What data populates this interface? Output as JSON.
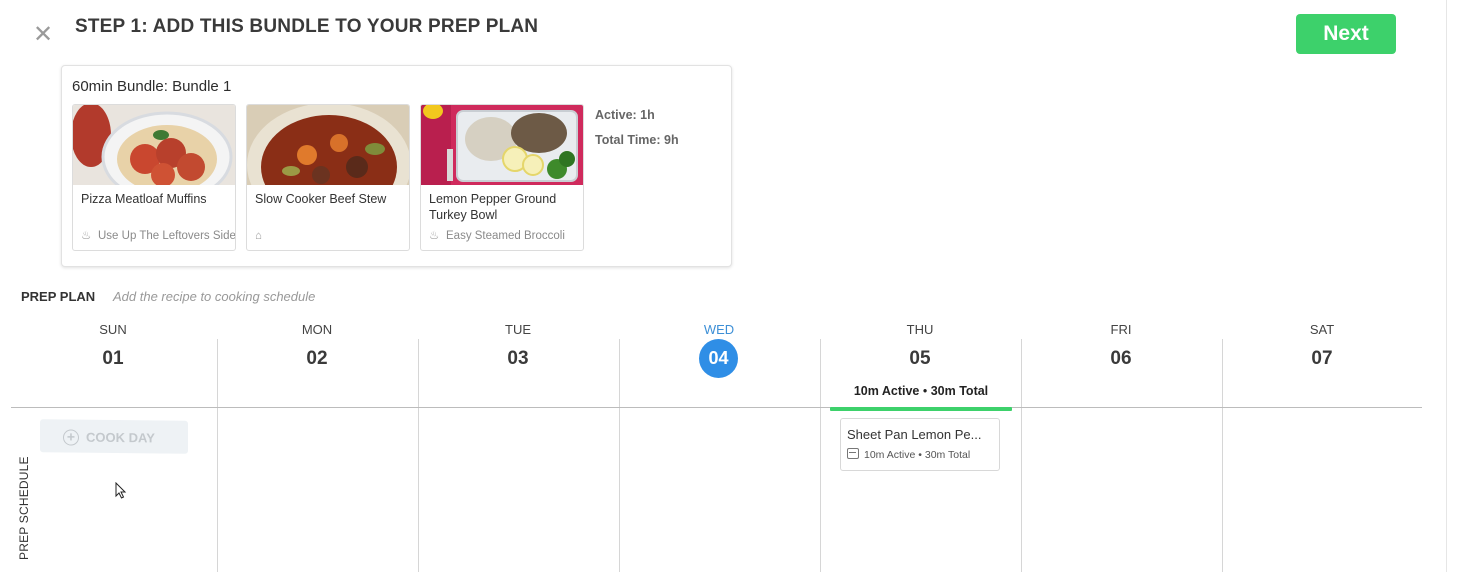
{
  "header": {
    "title": "STEP 1: ADD THIS BUNDLE TO YOUR PREP PLAN",
    "next_label": "Next",
    "close_icon": "close-icon"
  },
  "bundle": {
    "title": "60min Bundle: Bundle 1",
    "recipes": [
      {
        "name": "Pizza Meatloaf Muffins",
        "side": "Use Up The Leftovers Side",
        "side_icon": "steam-icon"
      },
      {
        "name": "Slow Cooker Beef Stew",
        "side": "",
        "side_icon": "slow-cooker-icon"
      },
      {
        "name": "Lemon Pepper Ground Turkey Bowl",
        "side": "Easy Steamed Broccoli",
        "side_icon": "steam-icon"
      }
    ],
    "active": "Active: 1h",
    "total": "Total Time: 9h"
  },
  "prep_plan": {
    "label": "PREP PLAN",
    "hint": "Add the recipe to cooking schedule",
    "side_label": "PREP SCHEDULE",
    "cook_day_label": "COOK DAY"
  },
  "days": [
    {
      "name": "SUN",
      "num": "01"
    },
    {
      "name": "MON",
      "num": "02"
    },
    {
      "name": "TUE",
      "num": "03"
    },
    {
      "name": "WED",
      "num": "04",
      "today": true
    },
    {
      "name": "THU",
      "num": "05"
    },
    {
      "name": "FRI",
      "num": "06"
    },
    {
      "name": "SAT",
      "num": "07"
    }
  ],
  "thu_summary": {
    "active": "10m Active",
    "dot": "•",
    "total": "30m Total"
  },
  "event": {
    "title": "Sheet Pan Lemon Pe...",
    "meta": "10m Active • 30m Total"
  },
  "colors": {
    "accent_green": "#3dd16b",
    "today_blue": "#2f8ee6"
  }
}
